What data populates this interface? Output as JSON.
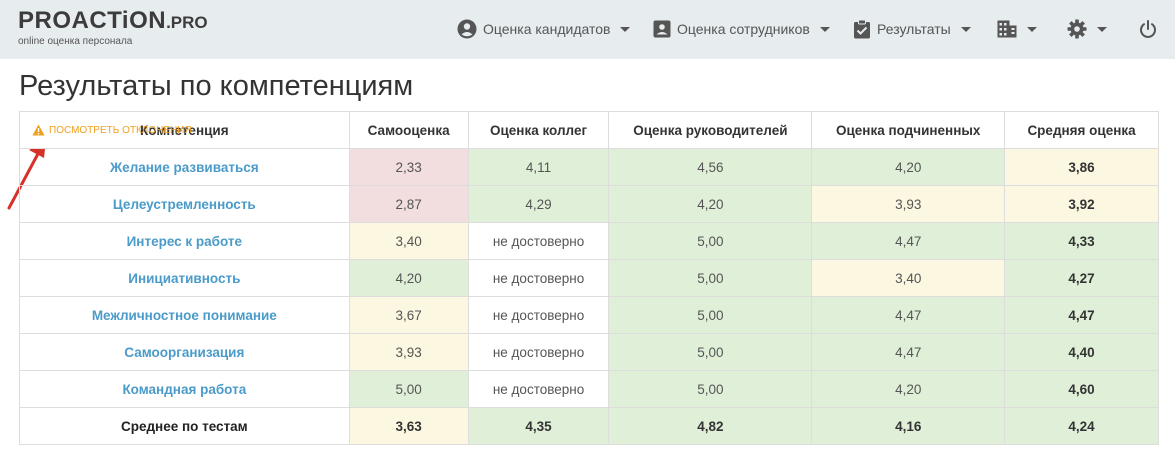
{
  "logo": {
    "brand": "PROACTiON",
    "suffix": ".PRO",
    "tagline": "online оценка персонала"
  },
  "nav": {
    "candidates": "Оценка кандидатов",
    "employees": "Оценка сотрудников",
    "results": "Результаты"
  },
  "title": "Результаты по компетенциям",
  "deviations_link": "Посмотреть отклонения",
  "headers": [
    "Компетенция",
    "Самооценка",
    "Оценка коллег",
    "Оценка руководителей",
    "Оценка подчиненных",
    "Средняя оценка"
  ],
  "rows": [
    {
      "name": "Желание развиваться",
      "values": [
        "2,33",
        "4,11",
        "4,56",
        "4,20",
        "3,86"
      ],
      "colors": [
        "r",
        "g",
        "g",
        "g",
        "y"
      ]
    },
    {
      "name": "Целеустремленность",
      "values": [
        "2,87",
        "4,29",
        "4,20",
        "3,93",
        "3,92"
      ],
      "colors": [
        "r",
        "g",
        "g",
        "y",
        "y"
      ]
    },
    {
      "name": "Интерес к работе",
      "values": [
        "3,40",
        "не достоверно",
        "5,00",
        "4,47",
        "4,33"
      ],
      "colors": [
        "y",
        "w",
        "g",
        "g",
        "g"
      ]
    },
    {
      "name": "Инициативность",
      "values": [
        "4,20",
        "не достоверно",
        "5,00",
        "3,40",
        "4,27"
      ],
      "colors": [
        "g",
        "w",
        "g",
        "y",
        "g"
      ]
    },
    {
      "name": "Межличностное понимание",
      "values": [
        "3,67",
        "не достоверно",
        "5,00",
        "4,47",
        "4,47"
      ],
      "colors": [
        "y",
        "w",
        "g",
        "g",
        "g"
      ]
    },
    {
      "name": "Самоорганизация",
      "values": [
        "3,93",
        "не достоверно",
        "5,00",
        "4,47",
        "4,40"
      ],
      "colors": [
        "y",
        "w",
        "g",
        "g",
        "g"
      ]
    },
    {
      "name": "Командная работа",
      "values": [
        "5,00",
        "не достоверно",
        "5,00",
        "4,20",
        "4,60"
      ],
      "colors": [
        "g",
        "w",
        "g",
        "g",
        "g"
      ]
    }
  ],
  "footer": {
    "name": "Среднее по тестам",
    "values": [
      "3,63",
      "4,35",
      "4,82",
      "4,16",
      "4,24"
    ],
    "colors": [
      "y",
      "g",
      "g",
      "g",
      "g"
    ]
  },
  "colors": {
    "green": "#e0f0d8",
    "yellow": "#fcf7e1",
    "red": "#f2dede",
    "link": "#4a9bc9",
    "warning": "#f0a020"
  }
}
